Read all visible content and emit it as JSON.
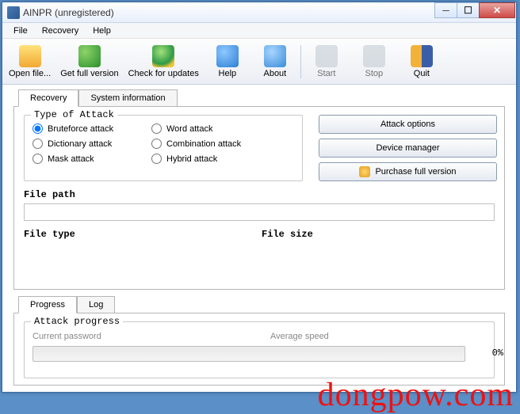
{
  "window": {
    "title": "AINPR (unregistered)"
  },
  "menu": {
    "file": "File",
    "recovery": "Recovery",
    "help": "Help"
  },
  "toolbar": {
    "open": "Open file...",
    "full": "Get full version",
    "updates": "Check for updates",
    "help": "Help",
    "about": "About",
    "start": "Start",
    "stop": "Stop",
    "quit": "Quit"
  },
  "tabs": {
    "recovery": "Recovery",
    "sysinfo": "System information"
  },
  "attack": {
    "legend": "Type of Attack",
    "bruteforce": "Bruteforce attack",
    "dictionary": "Dictionary attack",
    "mask": "Mask attack",
    "word": "Word attack",
    "combination": "Combination attack",
    "hybrid": "Hybrid attack"
  },
  "buttons": {
    "options": "Attack options",
    "device": "Device manager",
    "purchase": "Purchase full version"
  },
  "labels": {
    "filepath": "File path",
    "filetype": "File type",
    "filesize": "File size"
  },
  "progress": {
    "tab_progress": "Progress",
    "tab_log": "Log",
    "legend": "Attack progress",
    "current": "Current password",
    "speed": "Average speed",
    "pct": "0%"
  },
  "watermark": "dongpow.com"
}
